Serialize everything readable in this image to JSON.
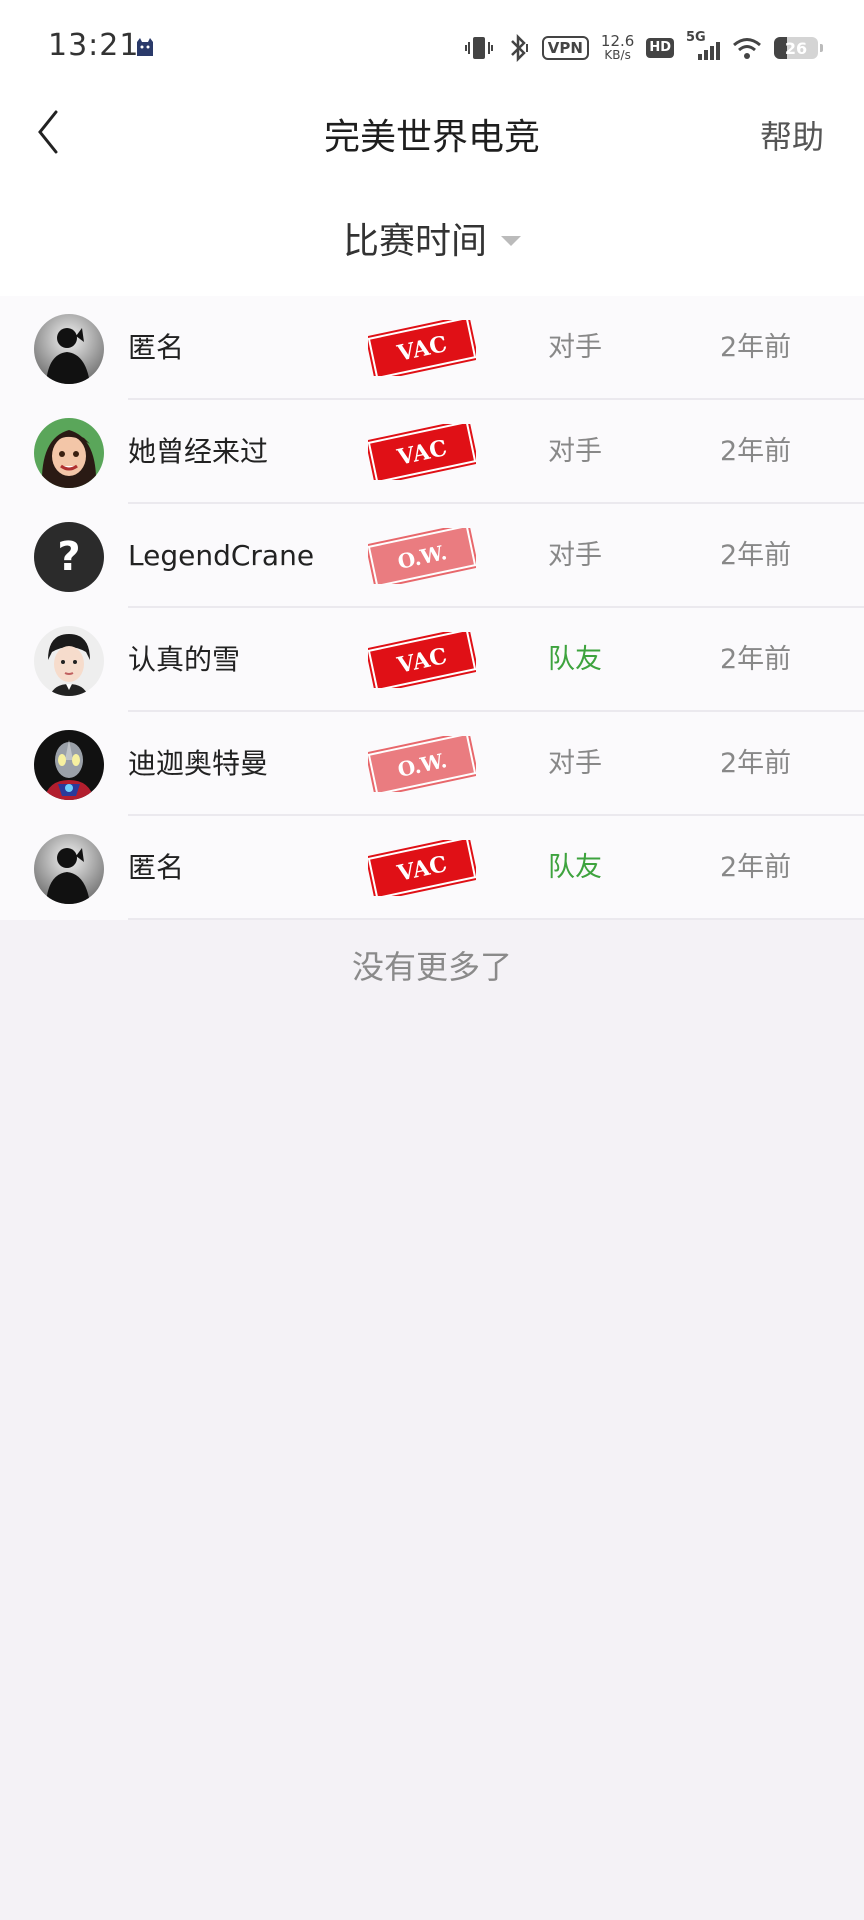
{
  "status_bar": {
    "time": "13:21",
    "vpn": "VPN",
    "speed_value": "12.6",
    "speed_unit": "KB/s",
    "hd": "HD",
    "network": "5G",
    "battery": "26"
  },
  "nav": {
    "title": "完美世界电竞",
    "help": "帮助"
  },
  "filter": {
    "label": "比赛时间"
  },
  "list": [
    {
      "name": "匿名",
      "ban": "VAC",
      "relation": "对手",
      "time": "2年前",
      "avatar": "silhouette-avatar"
    },
    {
      "name": "她曾经来过",
      "ban": "VAC",
      "relation": "对手",
      "time": "2年前",
      "avatar": "cartoon-girl-avatar"
    },
    {
      "name": "LegendCrane",
      "ban": "O.W.",
      "relation": "对手",
      "time": "2年前",
      "avatar": "question-mark-avatar"
    },
    {
      "name": "认真的雪",
      "ban": "VAC",
      "relation": "队友",
      "time": "2年前",
      "avatar": "person-photo-avatar"
    },
    {
      "name": "迪迦奥特曼",
      "ban": "O.W.",
      "relation": "对手",
      "time": "2年前",
      "avatar": "ultraman-avatar"
    },
    {
      "name": "匿名",
      "ban": "VAC",
      "relation": "队友",
      "time": "2年前",
      "avatar": "silhouette-avatar"
    }
  ],
  "footer": {
    "no_more": "没有更多了"
  },
  "colors": {
    "teammate": "#3ea33e",
    "opponent": "#888888",
    "vac_stamp": "#e01016",
    "ow_stamp": "#e8676b"
  }
}
